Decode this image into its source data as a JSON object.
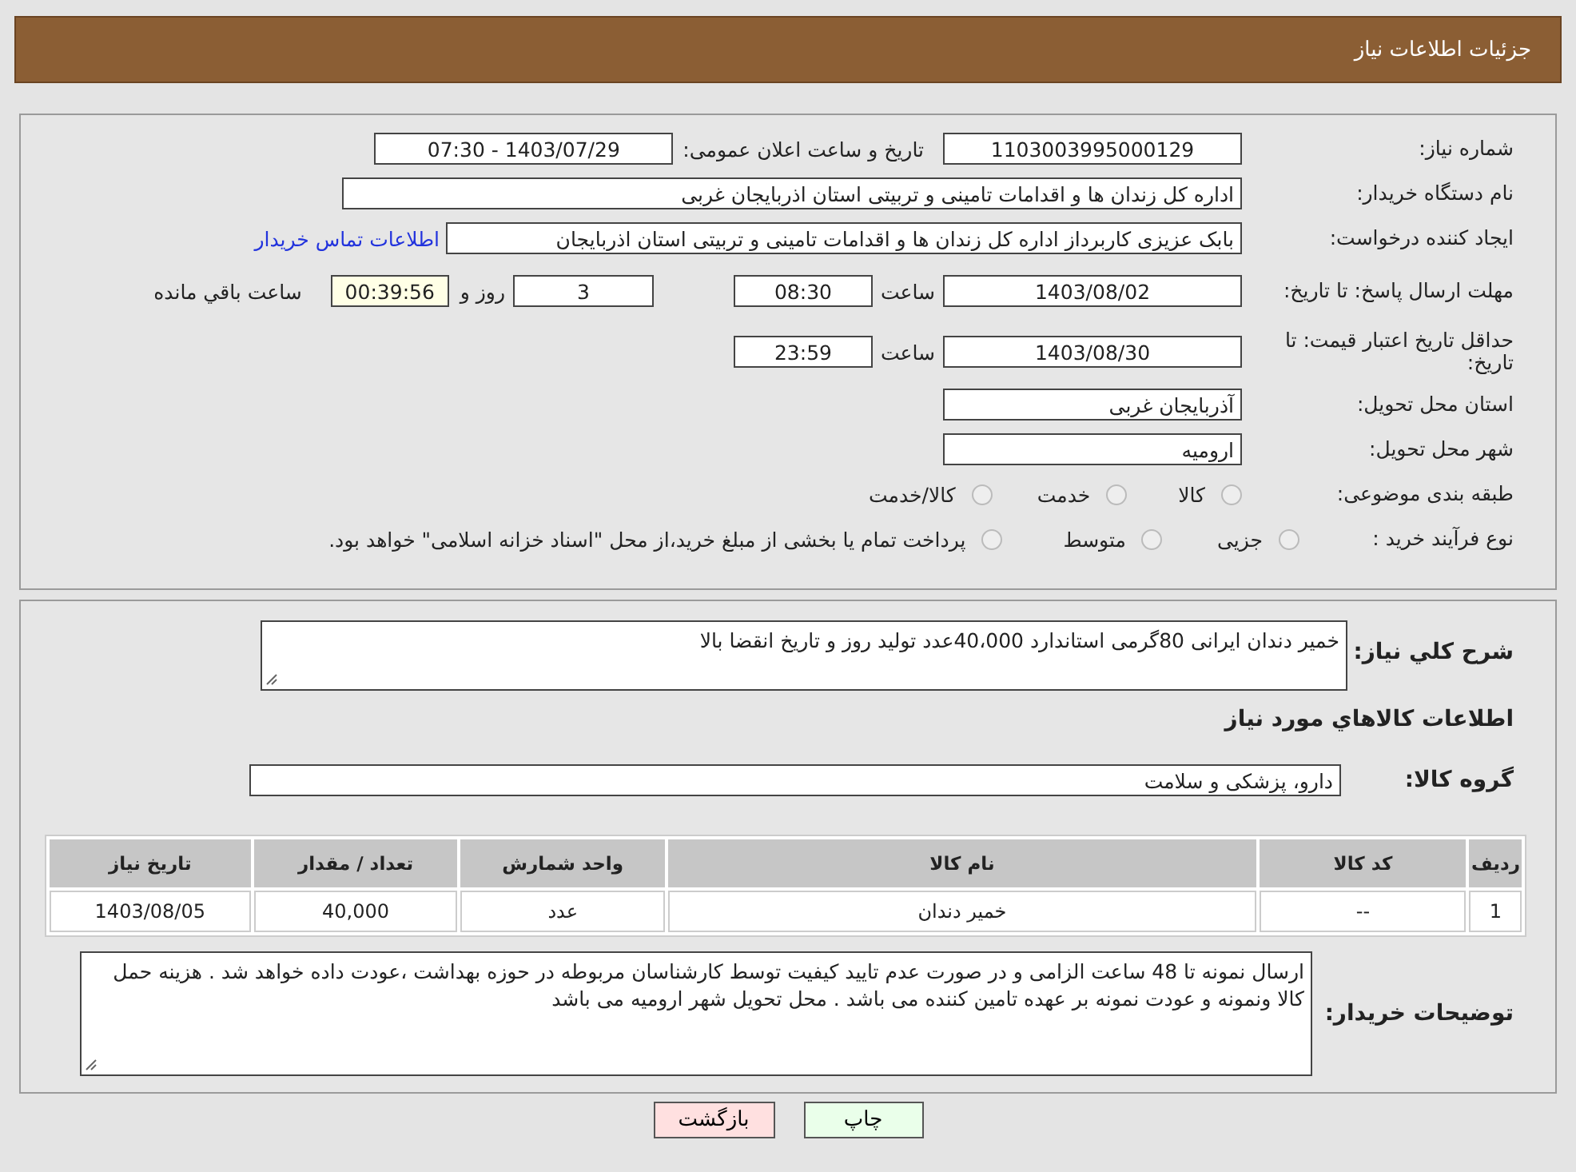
{
  "header": {
    "title": "جزئیات اطلاعات نیاز"
  },
  "need_number": {
    "label": "شماره نیاز:",
    "value": "1103003995000129"
  },
  "announce": {
    "label": "تاریخ و ساعت اعلان عمومی:",
    "value": "1403/07/29 - 07:30"
  },
  "buyer_org": {
    "label": "نام دستگاه خریدار:",
    "value": "اداره کل زندان ها و اقدامات تامینی و تربیتی استان اذربایجان غربی"
  },
  "requester": {
    "label": "ایجاد کننده درخواست:",
    "value": "بابک عزیزی کاربرداز اداره کل زندان ها و اقدامات تامینی و تربیتی استان اذربایجان",
    "contact_link": "اطلاعات تماس خریدار"
  },
  "deadline": {
    "label": "مهلت ارسال پاسخ: تا تاریخ:",
    "date": "1403/08/02",
    "time_label": "ساعت",
    "time": "08:30",
    "days": "3",
    "days_label": "روز و",
    "remaining": "00:39:56",
    "remaining_label": "ساعت باقي مانده"
  },
  "validity": {
    "label": "حداقل تاریخ اعتبار قیمت: تا تاریخ:",
    "date": "1403/08/30",
    "time_label": "ساعت",
    "time": "23:59"
  },
  "province": {
    "label": "استان محل تحویل:",
    "value": "آذربایجان غربی"
  },
  "city": {
    "label": "شهر محل تحویل:",
    "value": "ارومیه"
  },
  "category": {
    "label": "طبقه بندی موضوعی:",
    "options": [
      {
        "label": "کالا",
        "selected": false
      },
      {
        "label": "خدمت",
        "selected": false
      },
      {
        "label": "کالا/خدمت",
        "selected": false
      }
    ]
  },
  "purchase_process": {
    "label": "نوع فرآیند خرید :",
    "options": [
      {
        "label": "جزیی",
        "selected": false
      },
      {
        "label": "متوسط",
        "selected": false
      },
      {
        "label": "پرداخت تمام یا بخشی از مبلغ خرید،از محل \"اسناد خزانه اسلامی\" خواهد بود.",
        "selected": false
      }
    ]
  },
  "description": {
    "label": "شرح کلي نياز:",
    "value": "خمیر دندان ایرانی 80گرمی استاندارد  40،000عدد تولید روز و تاریخ انقضا بالا"
  },
  "goods_title": "اطلاعات کالاهاي مورد نياز",
  "goods_group": {
    "label": "گروه کالا:",
    "value": "دارو، پزشکی و سلامت"
  },
  "table": {
    "columns": [
      "ردیف",
      "کد کالا",
      "نام کالا",
      "واحد شمارش",
      "تعداد / مقدار",
      "تاریخ نیاز"
    ],
    "rows": [
      [
        "1",
        "--",
        "خمیر دندان",
        "عدد",
        "40,000",
        "1403/08/05"
      ]
    ]
  },
  "buyer_notes": {
    "label": "توضیحات خریدار:",
    "value": "ارسال نمونه تا 48  ساعت الزامی و در صورت عدم تایید کیفیت توسط کارشناسان مربوطه در حوزه بهداشت ،عودت داده خواهد شد . هزینه حمل کالا ونمونه و عودت نمونه بر عهده تامین کننده می باشد . محل تحویل شهر ارومیه  می باشد"
  },
  "buttons": [
    {
      "label": "چاپ",
      "kind": "print"
    },
    {
      "label": "بازگشت",
      "kind": "back"
    }
  ]
}
